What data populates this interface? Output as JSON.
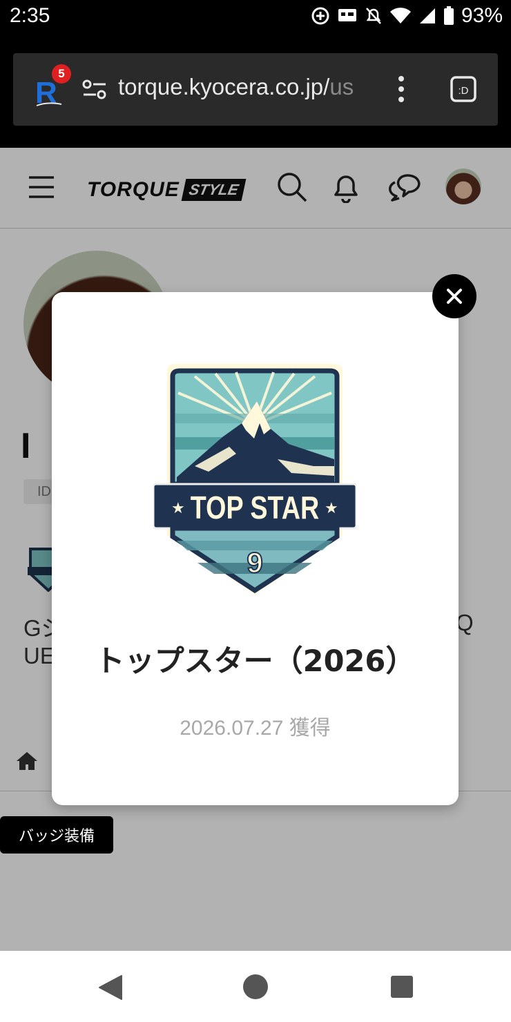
{
  "status_bar": {
    "time": "2:35",
    "battery": "93%"
  },
  "browser": {
    "url_main": "torque.kyocera.co.jp/",
    "url_faded": "us",
    "rakuten_badge_count": "5"
  },
  "site": {
    "logo_main": "TORQUE",
    "logo_style": "STYLE"
  },
  "background_page": {
    "name_fragment": "I",
    "id_fragment": "ID",
    "desc_line1_start": "Gジ",
    "desc_line1_end": "Q",
    "desc_line2_start": "UE",
    "equip_button": "バッジ装備"
  },
  "modal": {
    "badge_emblem_text": "TOP STAR",
    "badge_emblem_number": "9",
    "title": "トップスター（2026）",
    "earned_date": "2026.07.27 獲得"
  },
  "colors": {
    "badge_navy": "#1f3350",
    "badge_teal": "#7fc6c4",
    "badge_cream": "#fff8da"
  }
}
